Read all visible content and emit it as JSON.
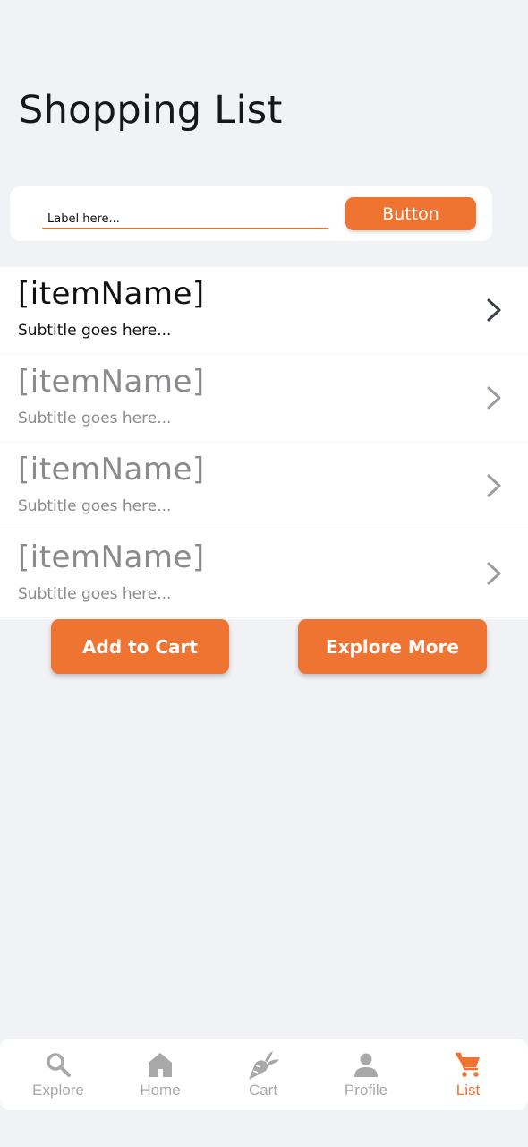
{
  "header": {
    "title": "Shopping List"
  },
  "input_card": {
    "placeholder": "Label here...",
    "button_label": "Button"
  },
  "list": {
    "items": [
      {
        "name": "[itemName]",
        "subtitle": "Subtitle goes here..."
      },
      {
        "name": "[itemName]",
        "subtitle": "Subtitle goes here..."
      },
      {
        "name": "[itemName]",
        "subtitle": "Subtitle goes here..."
      },
      {
        "name": "[itemName]",
        "subtitle": "Subtitle goes here..."
      }
    ]
  },
  "actions": {
    "add_to_cart": "Add to Cart",
    "explore_more": "Explore More"
  },
  "bottom_nav": {
    "items": [
      {
        "label": "Explore",
        "icon": "search-icon"
      },
      {
        "label": "Home",
        "icon": "home-icon"
      },
      {
        "label": "Cart",
        "icon": "carrot-icon"
      },
      {
        "label": "Profile",
        "icon": "person-icon"
      },
      {
        "label": "List",
        "icon": "shopping-cart-icon",
        "active": true
      }
    ]
  },
  "colors": {
    "accent": "#ef7432",
    "background": "#f1f2f6",
    "inactive_nav": "#a8a8a8"
  }
}
